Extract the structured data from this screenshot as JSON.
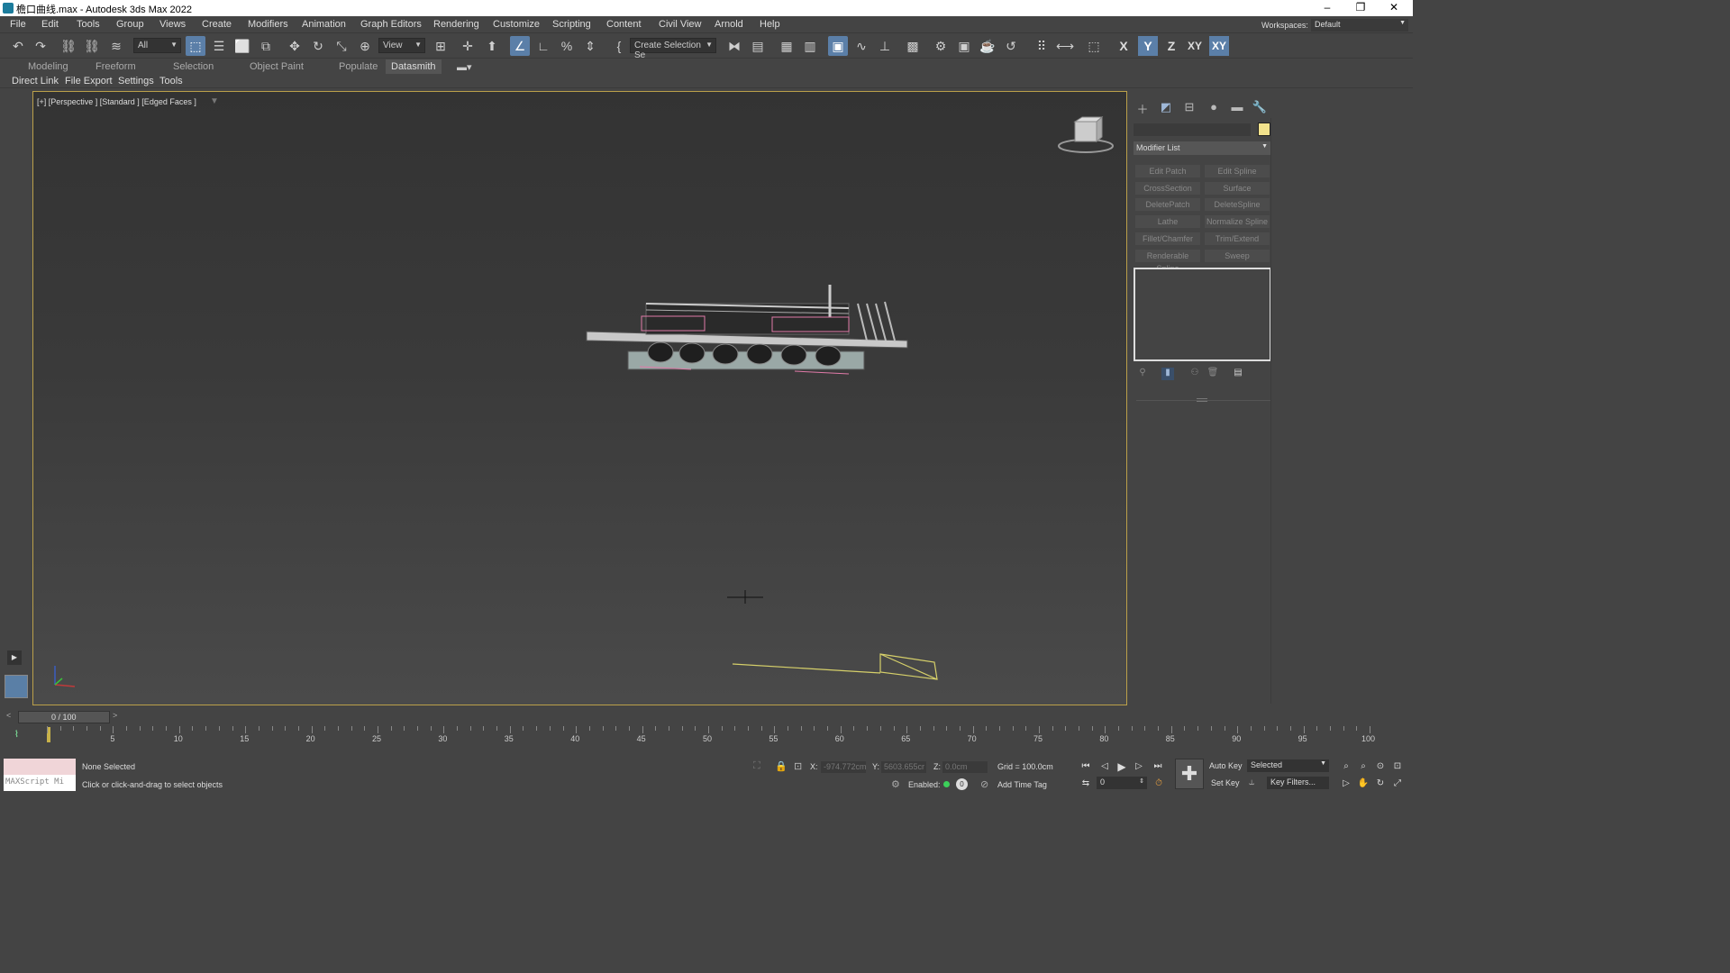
{
  "window": {
    "title": "檐口曲线.max - Autodesk 3ds Max 2022",
    "minimize": "–",
    "restore": "❐",
    "close": "✕"
  },
  "menubar": {
    "items": [
      "File",
      "Edit",
      "Tools",
      "Group",
      "Views",
      "Create",
      "Modifiers",
      "Animation",
      "Graph Editors",
      "Rendering",
      "Customize",
      "Scripting",
      "Content",
      "Civil View",
      "Arnold",
      "Help"
    ],
    "workspaces_label": "Workspaces:",
    "workspace_value": "Default"
  },
  "toolbar": {
    "selection_filter": "All",
    "ref_coord": "View",
    "selection_set": "Create Selection Se",
    "axes": [
      "X",
      "Y",
      "Z",
      "XY",
      "XY"
    ]
  },
  "ribbon": {
    "tabs": [
      "Modeling",
      "Freeform",
      "Selection",
      "Object Paint",
      "Populate",
      "Datasmith"
    ],
    "active_tab": "Datasmith"
  },
  "subbar": {
    "items": [
      "Direct Link",
      "File Export",
      "Settings",
      "Tools"
    ]
  },
  "viewport": {
    "label": "[+] [Perspective ] [Standard ] [Edged Faces ]"
  },
  "command_panel": {
    "modifier_list": "Modifier List",
    "swatch_color": "#f2e28c",
    "buttons": [
      [
        "Edit Patch",
        "Edit Spline"
      ],
      [
        "CrossSection",
        "Surface"
      ],
      [
        "DeletePatch",
        "DeleteSpline"
      ],
      [
        "Lathe",
        "Normalize Spline"
      ],
      [
        "Fillet/Chamfer",
        "Trim/Extend"
      ],
      [
        "Renderable Spline",
        "Sweep"
      ]
    ]
  },
  "timeline": {
    "frame_display": "0 / 100",
    "ticks": [
      "5",
      "10",
      "15",
      "20",
      "25",
      "30",
      "35",
      "40",
      "45",
      "50",
      "55",
      "60",
      "65",
      "70",
      "75",
      "80",
      "85",
      "90",
      "95",
      "100"
    ]
  },
  "statusbar": {
    "maxscript_label": "MAXScript Mi",
    "selection_status": "None Selected",
    "prompt": "Click or click-and-drag to select objects",
    "x_label": "X:",
    "x_value": "-974.772cm",
    "y_label": "Y:",
    "y_value": "5603.655cr",
    "z_label": "Z:",
    "z_value": "0.0cm",
    "grid": "Grid = 100.0cm",
    "enabled_label": "Enabled:",
    "add_time_tag": "Add Time Tag",
    "auto_key": "Auto Key",
    "set_key": "Set Key",
    "selected_dropdown": "Selected",
    "key_filters": "Key Filters...",
    "frame_input": "0"
  }
}
